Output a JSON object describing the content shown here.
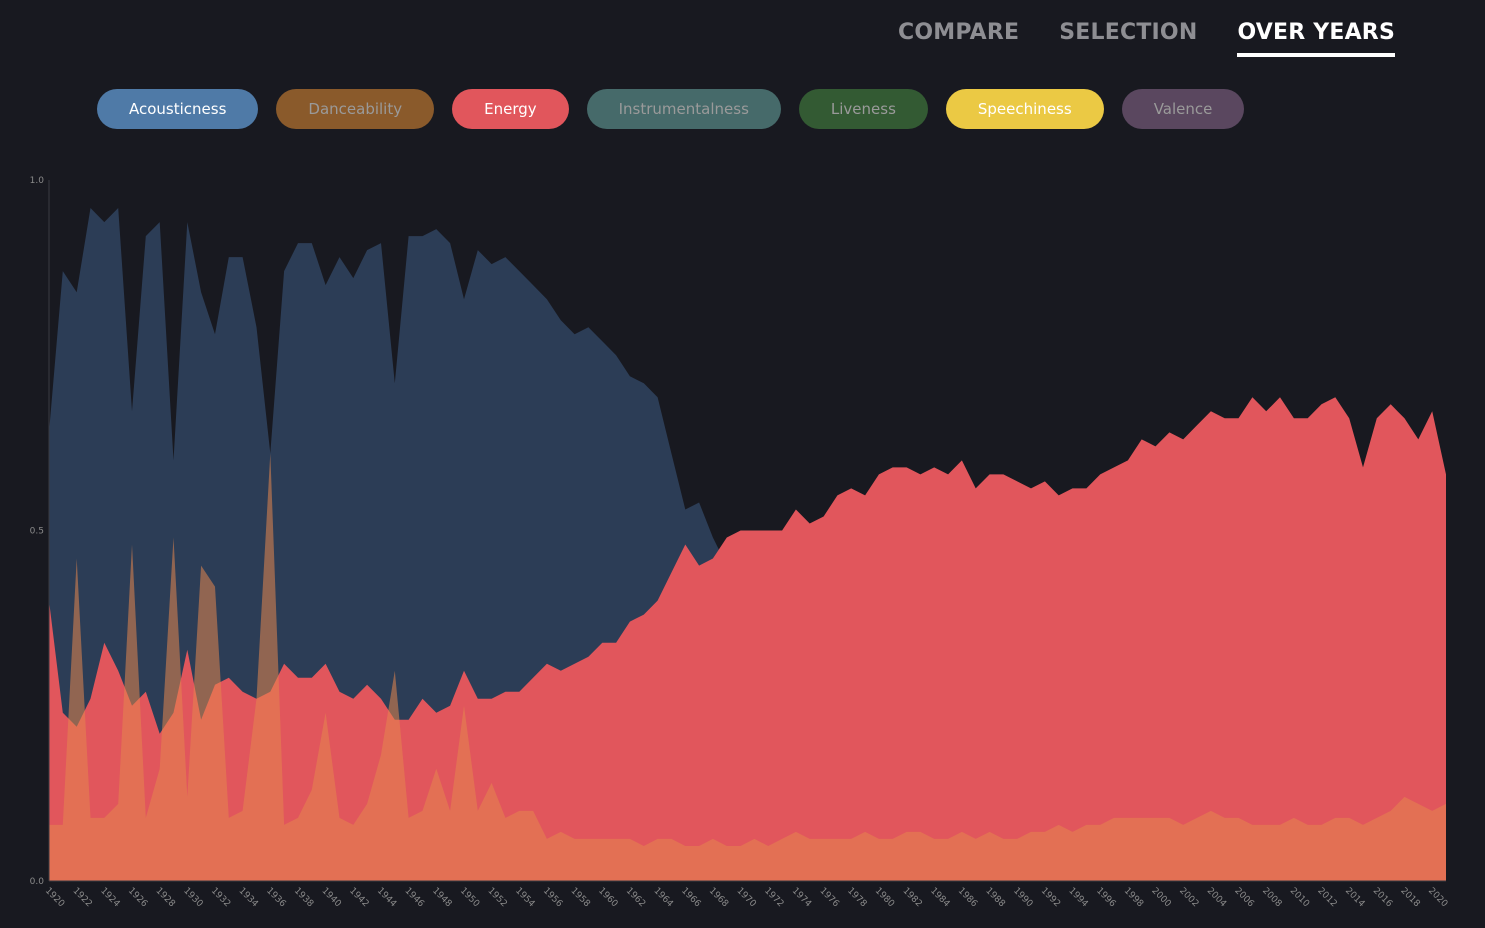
{
  "nav": {
    "tabs": [
      {
        "label": "COMPARE",
        "active": false
      },
      {
        "label": "SELECTION",
        "active": false
      },
      {
        "label": "OVER YEARS",
        "active": true
      }
    ]
  },
  "filters": [
    {
      "label": "Acousticness",
      "color": "#4f7aa7",
      "active": true
    },
    {
      "label": "Danceability",
      "color": "#8a5a2b",
      "active": false
    },
    {
      "label": "Energy",
      "color": "#e1565c",
      "active": true
    },
    {
      "label": "Instrumentalness",
      "color": "#466a6a",
      "active": false
    },
    {
      "label": "Liveness",
      "color": "#335a33",
      "active": false
    },
    {
      "label": "Speechiness",
      "color": "#ebc944",
      "active": true
    },
    {
      "label": "Valence",
      "color": "#5a475f",
      "active": false
    }
  ],
  "chart_data": {
    "type": "area",
    "ylim": [
      0,
      1
    ],
    "xlim": [
      1920,
      2021
    ],
    "y_ticks": [
      "0.0",
      "0.5",
      "1.0"
    ],
    "x_ticks": [
      "1920",
      "1922",
      "1924",
      "1926",
      "1928",
      "1930",
      "1932",
      "1934",
      "1936",
      "1938",
      "1940",
      "1942",
      "1944",
      "1946",
      "1948",
      "1950",
      "1952",
      "1954",
      "1956",
      "1958",
      "1960",
      "1962",
      "1964",
      "1966",
      "1968",
      "1970",
      "1972",
      "1974",
      "1976",
      "1978",
      "1980",
      "1982",
      "1984",
      "1986",
      "1988",
      "1990",
      "1992",
      "1994",
      "1996",
      "1998",
      "2000",
      "2002",
      "2004",
      "2006",
      "2008",
      "2010",
      "2012",
      "2014",
      "2016",
      "2018",
      "2020"
    ],
    "grid": false,
    "x": [
      1920,
      1921,
      1922,
      1923,
      1924,
      1925,
      1926,
      1927,
      1928,
      1929,
      1930,
      1931,
      1932,
      1933,
      1934,
      1935,
      1936,
      1937,
      1938,
      1939,
      1940,
      1941,
      1942,
      1943,
      1944,
      1945,
      1946,
      1947,
      1948,
      1949,
      1950,
      1951,
      1952,
      1953,
      1954,
      1955,
      1956,
      1957,
      1958,
      1959,
      1960,
      1961,
      1962,
      1963,
      1964,
      1965,
      1966,
      1967,
      1968,
      1969,
      1970,
      1971,
      1972,
      1973,
      1974,
      1975,
      1976,
      1977,
      1978,
      1979,
      1980,
      1981,
      1982,
      1983,
      1984,
      1985,
      1986,
      1987,
      1988,
      1989,
      1990,
      1991,
      1992,
      1993,
      1994,
      1995,
      1996,
      1997,
      1998,
      1999,
      2000,
      2001,
      2002,
      2003,
      2004,
      2005,
      2006,
      2007,
      2008,
      2009,
      2010,
      2011,
      2012,
      2013,
      2014,
      2015,
      2016,
      2017,
      2018,
      2019,
      2020,
      2021
    ],
    "series": [
      {
        "name": "Acousticness",
        "color": "#2c3d56",
        "values": [
          0.64,
          0.87,
          0.84,
          0.96,
          0.94,
          0.96,
          0.67,
          0.92,
          0.94,
          0.6,
          0.94,
          0.84,
          0.78,
          0.89,
          0.89,
          0.79,
          0.61,
          0.87,
          0.91,
          0.91,
          0.85,
          0.89,
          0.86,
          0.9,
          0.91,
          0.71,
          0.92,
          0.92,
          0.93,
          0.91,
          0.83,
          0.9,
          0.88,
          0.89,
          0.87,
          0.85,
          0.83,
          0.8,
          0.78,
          0.79,
          0.77,
          0.75,
          0.72,
          0.71,
          0.69,
          0.61,
          0.53,
          0.54,
          0.49,
          0.45,
          0.41,
          0.39,
          0.37,
          0.36,
          0.34,
          0.33,
          0.32,
          0.3,
          0.28,
          0.27,
          0.25,
          0.24,
          0.23,
          0.22,
          0.22,
          0.21,
          0.2,
          0.2,
          0.19,
          0.19,
          0.18,
          0.18,
          0.18,
          0.17,
          0.17,
          0.17,
          0.16,
          0.16,
          0.16,
          0.16,
          0.16,
          0.16,
          0.15,
          0.15,
          0.15,
          0.15,
          0.15,
          0.14,
          0.15,
          0.14,
          0.15,
          0.14,
          0.14,
          0.14,
          0.14,
          0.15,
          0.15,
          0.15,
          0.14,
          0.15,
          0.14,
          0.15
        ]
      },
      {
        "name": "Energy",
        "color": "#e1565c",
        "values": [
          0.4,
          0.24,
          0.22,
          0.26,
          0.34,
          0.3,
          0.25,
          0.27,
          0.21,
          0.24,
          0.33,
          0.23,
          0.28,
          0.29,
          0.27,
          0.26,
          0.27,
          0.31,
          0.29,
          0.29,
          0.31,
          0.27,
          0.26,
          0.28,
          0.26,
          0.23,
          0.23,
          0.26,
          0.24,
          0.25,
          0.3,
          0.26,
          0.26,
          0.27,
          0.27,
          0.29,
          0.31,
          0.3,
          0.31,
          0.32,
          0.34,
          0.34,
          0.37,
          0.38,
          0.4,
          0.44,
          0.48,
          0.45,
          0.46,
          0.49,
          0.5,
          0.5,
          0.5,
          0.5,
          0.53,
          0.51,
          0.52,
          0.55,
          0.56,
          0.55,
          0.58,
          0.59,
          0.59,
          0.58,
          0.59,
          0.58,
          0.6,
          0.56,
          0.58,
          0.58,
          0.57,
          0.56,
          0.57,
          0.55,
          0.56,
          0.56,
          0.58,
          0.59,
          0.6,
          0.63,
          0.62,
          0.64,
          0.63,
          0.65,
          0.67,
          0.66,
          0.66,
          0.69,
          0.67,
          0.69,
          0.66,
          0.66,
          0.68,
          0.69,
          0.66,
          0.59,
          0.66,
          0.68,
          0.66,
          0.63,
          0.67,
          0.58
        ]
      },
      {
        "name": "Speechiness",
        "color": "#e6864f",
        "values": [
          0.08,
          0.08,
          0.46,
          0.09,
          0.09,
          0.11,
          0.48,
          0.09,
          0.16,
          0.49,
          0.12,
          0.45,
          0.42,
          0.09,
          0.1,
          0.26,
          0.61,
          0.08,
          0.09,
          0.13,
          0.24,
          0.09,
          0.08,
          0.11,
          0.18,
          0.3,
          0.09,
          0.1,
          0.16,
          0.1,
          0.25,
          0.1,
          0.14,
          0.09,
          0.1,
          0.1,
          0.06,
          0.07,
          0.06,
          0.06,
          0.06,
          0.06,
          0.06,
          0.05,
          0.06,
          0.06,
          0.05,
          0.05,
          0.06,
          0.05,
          0.05,
          0.06,
          0.05,
          0.06,
          0.07,
          0.06,
          0.06,
          0.06,
          0.06,
          0.07,
          0.06,
          0.06,
          0.07,
          0.07,
          0.06,
          0.06,
          0.07,
          0.06,
          0.07,
          0.06,
          0.06,
          0.07,
          0.07,
          0.08,
          0.07,
          0.08,
          0.08,
          0.09,
          0.09,
          0.09,
          0.09,
          0.09,
          0.08,
          0.09,
          0.1,
          0.09,
          0.09,
          0.08,
          0.08,
          0.08,
          0.09,
          0.08,
          0.08,
          0.09,
          0.09,
          0.08,
          0.09,
          0.1,
          0.12,
          0.11,
          0.1,
          0.11
        ]
      }
    ]
  }
}
